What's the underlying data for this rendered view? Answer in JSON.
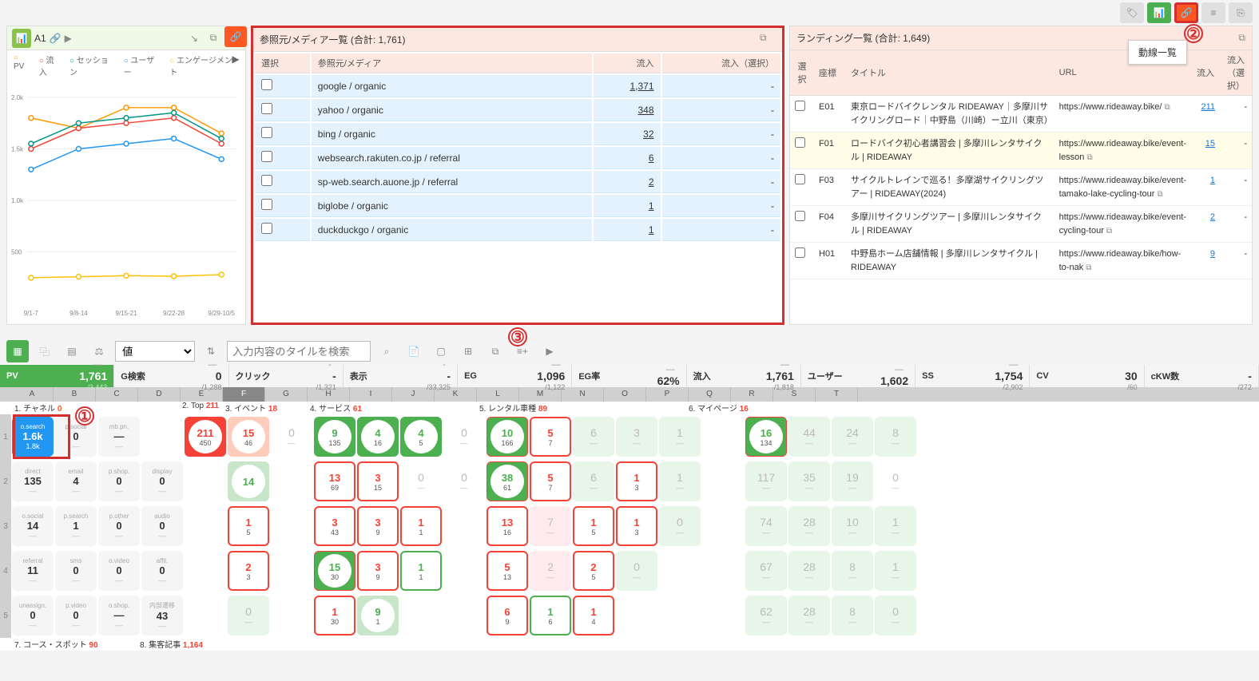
{
  "top_toolbar": {
    "tooltip": "動線一覧",
    "annotation_2": "②"
  },
  "chart_panel": {
    "cell_ref": "A1",
    "legend": [
      "PV",
      "流入",
      "セッション",
      "ユーザー",
      "エンゲージメント"
    ]
  },
  "chart_data": {
    "type": "line",
    "categories": [
      "9/1-7",
      "9/8-14",
      "9/15-21",
      "9/22-28",
      "9/29-10/5"
    ],
    "series": [
      {
        "name": "PV",
        "color": "#ff9800",
        "values": [
          1800,
          1700,
          1900,
          1900,
          1650
        ]
      },
      {
        "name": "流入",
        "color": "#f44336",
        "values": [
          1500,
          1700,
          1750,
          1800,
          1550
        ]
      },
      {
        "name": "セッション",
        "color": "#009688",
        "values": [
          1550,
          1750,
          1800,
          1850,
          1600
        ]
      },
      {
        "name": "ユーザー",
        "color": "#2196f3",
        "values": [
          1300,
          1500,
          1550,
          1600,
          1400
        ]
      },
      {
        "name": "エンゲージメント",
        "color": "#ffc107",
        "values": [
          250,
          260,
          270,
          265,
          280
        ]
      }
    ],
    "ylim": [
      0,
      2000
    ],
    "yticks": [
      "500",
      "1.0k",
      "1.5k",
      "2.0k"
    ]
  },
  "referrer": {
    "title": "参照元/メディア一覧 (合計: 1,761)",
    "annotation_3": "③",
    "columns": [
      "選択",
      "参照元/メディア",
      "流入",
      "流入（選択）"
    ],
    "rows": [
      {
        "name": "google / organic",
        "inflow": "1,371",
        "selected": "-"
      },
      {
        "name": "yahoo / organic",
        "inflow": "348",
        "selected": "-"
      },
      {
        "name": "bing / organic",
        "inflow": "32",
        "selected": "-"
      },
      {
        "name": "websearch.rakuten.co.jp / referral",
        "inflow": "6",
        "selected": "-"
      },
      {
        "name": "sp-web.search.auone.jp / referral",
        "inflow": "2",
        "selected": "-"
      },
      {
        "name": "biglobe / organic",
        "inflow": "1",
        "selected": "-"
      },
      {
        "name": "duckduckgo / organic",
        "inflow": "1",
        "selected": "-"
      }
    ]
  },
  "landing": {
    "title": "ランディング一覧 (合計: 1,649)",
    "columns": [
      "選択",
      "座標",
      "タイトル",
      "URL",
      "流入",
      "流入（選択）"
    ],
    "rows": [
      {
        "coord": "E01",
        "title": "東京ロードバイクレンタル RIDEAWAY｜多摩川サイクリングロード｜中野島（川崎）ー立川（東京）",
        "url": "https://www.rideaway.bike/",
        "inflow": "211",
        "sel": "-",
        "hl": false
      },
      {
        "coord": "F01",
        "title": "ロードバイク初心者講習会 | 多摩川レンタサイクル | RIDEAWAY",
        "url": "https://www.rideaway.bike/event-lesson",
        "inflow": "15",
        "sel": "-",
        "hl": true
      },
      {
        "coord": "F03",
        "title": "サイクルトレインで巡る！多摩湖サイクリングツアー | RIDEAWAY(2024)",
        "url": "https://www.rideaway.bike/event-tamako-lake-cycling-tour",
        "inflow": "1",
        "sel": "-",
        "hl": false
      },
      {
        "coord": "F04",
        "title": "多摩川サイクリングツアー | 多摩川レンタサイクル | RIDEAWAY",
        "url": "https://www.rideaway.bike/event-cycling-tour",
        "inflow": "2",
        "sel": "-",
        "hl": false
      },
      {
        "coord": "H01",
        "title": "中野島ホーム店舗情報 | 多摩川レンタサイクル | RIDEAWAY",
        "url": "https://www.rideaway.bike/how-to-nak",
        "inflow": "9",
        "sel": "-",
        "hl": false
      }
    ]
  },
  "metrics_toolbar": {
    "select_value": "値",
    "search_placeholder": "入力内容のタイルを検索"
  },
  "metrics": [
    {
      "label": "PV",
      "dash": "—",
      "big": "1,761",
      "small": "/3,443",
      "green": true
    },
    {
      "label": "G検索",
      "dash": "—",
      "big": "0",
      "small": "/1,288"
    },
    {
      "label": "クリック",
      "dash": "-",
      "big": "-",
      "small": "/1,321"
    },
    {
      "label": "表示",
      "dash": "-",
      "big": "-",
      "small": "/33,325"
    },
    {
      "label": "EG",
      "dash": "—",
      "big": "1,096",
      "small": "/1,122"
    },
    {
      "label": "EG率",
      "dash": "—",
      "big": "62%",
      "small": ""
    },
    {
      "label": "流入",
      "dash": "—",
      "big": "1,761",
      "small": "/1,818"
    },
    {
      "label": "ユーザー",
      "dash": "—",
      "big": "1,602",
      "small": ""
    },
    {
      "label": "SS",
      "dash": "—",
      "big": "1,754",
      "small": "/2,902"
    },
    {
      "label": "CV",
      "dash": "",
      "big": "30",
      "small": "/60"
    },
    {
      "label": "cKW数",
      "dash": "",
      "big": "-",
      "small": "/272"
    }
  ],
  "col_letters": [
    "A",
    "B",
    "C",
    "D",
    "E",
    "F",
    "G",
    "H",
    "I",
    "J",
    "K",
    "L",
    "M",
    "N",
    "O",
    "P",
    "Q",
    "R",
    "S",
    "T"
  ],
  "sections": [
    {
      "pos": 18,
      "label": "1. チャネル",
      "val": "0",
      "color": "sh-orange"
    },
    {
      "pos": 228,
      "label": "2. Top",
      "val": "211",
      "color": "sh-red"
    },
    {
      "pos": 282,
      "label": "3. イベント",
      "val": "18",
      "color": "sh-red"
    },
    {
      "pos": 388,
      "label": "4. サービス",
      "val": "61",
      "color": "sh-red"
    },
    {
      "pos": 600,
      "label": "5. レンタル車種",
      "val": "89",
      "color": "sh-red"
    },
    {
      "pos": 862,
      "label": "6. マイページ",
      "val": "16",
      "color": "sh-red"
    }
  ],
  "sections_bottom": [
    {
      "pos": 18,
      "label": "7. コース・スポット",
      "val": "90",
      "color": "sh-red"
    },
    {
      "pos": 175,
      "label": "8. 集客記事",
      "val": "1,164",
      "color": "sh-red"
    }
  ],
  "annotation_1": "①",
  "grid": {
    "row1": {
      "channel": [
        {
          "t": "o.search",
          "v1": "1.6k",
          "v2": "1.8k",
          "selblue": true
        },
        {
          "t": "p.social",
          "v": "0"
        },
        {
          "t": "mb.pn.",
          "v": "—"
        }
      ],
      "tiles": [
        {
          "c": "E",
          "v1": "211",
          "v2": "450",
          "bg": "bg-red"
        },
        {
          "c": "F",
          "v1": "15",
          "v2": "46",
          "bg": "bg-orange"
        },
        {
          "c": "G",
          "v": "0"
        },
        {
          "c": "H",
          "v1": "9",
          "v2": "135",
          "bg": "bg-green"
        },
        {
          "c": "I",
          "v1": "4",
          "v2": "16",
          "bg": "bg-green"
        },
        {
          "c": "J",
          "v1": "4",
          "v2": "5",
          "bg": "bg-green"
        },
        {
          "c": "K",
          "v": "0"
        },
        {
          "c": "L",
          "v1": "10",
          "v2": "166",
          "bg": "bg-green",
          "red": true
        },
        {
          "c": "M",
          "v1": "5",
          "v2": "7",
          "bg": "bord-red"
        },
        {
          "c": "N",
          "v": "6",
          "fade": "bg-fade-green"
        },
        {
          "c": "O",
          "v": "3",
          "fade": "bg-fade-green"
        },
        {
          "c": "P",
          "v": "1",
          "fade": "bg-fade-green"
        },
        {
          "c": "Q",
          "blank": true
        },
        {
          "c": "R",
          "v1": "16",
          "v2": "134",
          "bg": "bg-green",
          "red": true
        },
        {
          "c": "S",
          "v": "44",
          "fade": "bg-fade-green"
        },
        {
          "c": "T",
          "v": "24",
          "fade": "bg-fade-green"
        },
        {
          "c": "U",
          "v": "8",
          "fade": "bg-fade-green"
        }
      ]
    },
    "row2": {
      "channel": [
        {
          "t": "direct",
          "v": "135"
        },
        {
          "t": "email",
          "v": "4"
        },
        {
          "t": "p.shop.",
          "v": "0"
        },
        {
          "t": "display",
          "v": "0"
        }
      ],
      "tiles": [
        {
          "c": "E",
          "blank": true
        },
        {
          "c": "F",
          "v1": "14",
          "bg": "bg-lightgreen",
          "single": true
        },
        {
          "c": "G",
          "blank": true
        },
        {
          "c": "H",
          "v1": "13",
          "v2": "69",
          "bg": "bord-red"
        },
        {
          "c": "I",
          "v1": "3",
          "v2": "15",
          "bg": "bord-red"
        },
        {
          "c": "J",
          "v": "0"
        },
        {
          "c": "K",
          "v": "0"
        },
        {
          "c": "L",
          "v1": "38",
          "v2": "61",
          "bg": "bg-green",
          "red": true
        },
        {
          "c": "M",
          "v1": "5",
          "v2": "7",
          "bg": "bord-red"
        },
        {
          "c": "N",
          "v": "6",
          "fade": "bg-fade-green"
        },
        {
          "c": "O",
          "v1": "1",
          "v2": "3",
          "bg": "bord-red"
        },
        {
          "c": "P",
          "v": "1",
          "fade": "bg-fade-green"
        },
        {
          "c": "Q",
          "blank": true
        },
        {
          "c": "R",
          "v": "117",
          "fade": "bg-fade-green"
        },
        {
          "c": "S",
          "v": "35",
          "fade": "bg-fade-green"
        },
        {
          "c": "T",
          "v": "19",
          "fade": "bg-fade-green"
        },
        {
          "c": "U",
          "v": "0"
        }
      ]
    },
    "row3": {
      "channel": [
        {
          "t": "o.social",
          "v": "14"
        },
        {
          "t": "p.search",
          "v": "1"
        },
        {
          "t": "p.other",
          "v": "0"
        },
        {
          "t": "audio",
          "v": "0"
        }
      ],
      "tiles": [
        {
          "c": "E",
          "blank": true
        },
        {
          "c": "F",
          "v1": "1",
          "v2": "5",
          "bg": "bord-red"
        },
        {
          "c": "G",
          "blank": true
        },
        {
          "c": "H",
          "v1": "3",
          "v2": "43",
          "bg": "bord-red"
        },
        {
          "c": "I",
          "v1": "3",
          "v2": "9",
          "bg": "bord-red"
        },
        {
          "c": "J",
          "v1": "1",
          "v2": "1",
          "bg": "bord-red"
        },
        {
          "c": "K",
          "blank": true
        },
        {
          "c": "L",
          "v1": "13",
          "v2": "16",
          "bg": "bord-red"
        },
        {
          "c": "M",
          "v": "7",
          "fade": "bg-fade-red"
        },
        {
          "c": "N",
          "v1": "1",
          "v2": "5",
          "bg": "bord-red"
        },
        {
          "c": "O",
          "v1": "1",
          "v2": "3",
          "bg": "bord-red"
        },
        {
          "c": "P",
          "v": "0",
          "fade": "bg-fade-green"
        },
        {
          "c": "Q",
          "blank": true
        },
        {
          "c": "R",
          "v": "74",
          "fade": "bg-fade-green"
        },
        {
          "c": "S",
          "v": "28",
          "fade": "bg-fade-green"
        },
        {
          "c": "T",
          "v": "10",
          "fade": "bg-fade-green"
        },
        {
          "c": "U",
          "v": "1",
          "fade": "bg-fade-green"
        }
      ]
    },
    "row4": {
      "channel": [
        {
          "t": "referral",
          "v": "11"
        },
        {
          "t": "sms",
          "v": "0"
        },
        {
          "t": "o.video",
          "v": "0"
        },
        {
          "t": "affil.",
          "v": "0"
        }
      ],
      "tiles": [
        {
          "c": "E",
          "blank": true
        },
        {
          "c": "F",
          "v1": "2",
          "v2": "3",
          "bg": "bord-red"
        },
        {
          "c": "G",
          "blank": true
        },
        {
          "c": "H",
          "v1": "15",
          "v2": "30",
          "bg": "bg-green",
          "red": true
        },
        {
          "c": "I",
          "v1": "3",
          "v2": "9",
          "bg": "bord-red"
        },
        {
          "c": "J",
          "v1": "1",
          "v2": "1",
          "bg": "bord-green"
        },
        {
          "c": "K",
          "blank": true
        },
        {
          "c": "L",
          "v1": "5",
          "v2": "13",
          "bg": "bord-red"
        },
        {
          "c": "M",
          "v": "2",
          "fade": "bg-fade-red"
        },
        {
          "c": "N",
          "v1": "2",
          "v2": "5",
          "bg": "bord-red"
        },
        {
          "c": "O",
          "v": "0",
          "fade": "bg-fade-green"
        },
        {
          "c": "P",
          "blank": true
        },
        {
          "c": "Q",
          "blank": true
        },
        {
          "c": "R",
          "v": "67",
          "fade": "bg-fade-green"
        },
        {
          "c": "S",
          "v": "28",
          "fade": "bg-fade-green"
        },
        {
          "c": "T",
          "v": "8",
          "fade": "bg-fade-green"
        },
        {
          "c": "U",
          "v": "1",
          "fade": "bg-fade-green"
        }
      ]
    },
    "row5": {
      "channel": [
        {
          "t": "unassign.",
          "v": "0"
        },
        {
          "t": "p.video",
          "v": "0"
        },
        {
          "t": "o.shop.",
          "v": "—"
        },
        {
          "t": "内部遷移",
          "v": "43"
        }
      ],
      "tiles": [
        {
          "c": "E",
          "blank": true
        },
        {
          "c": "F",
          "v": "0",
          "fade": "bg-fade-green"
        },
        {
          "c": "G",
          "blank": true
        },
        {
          "c": "H",
          "v1": "1",
          "v2": "30",
          "bg": "bord-red"
        },
        {
          "c": "I",
          "v1": "9",
          "v2": "1",
          "bg": "bg-lightgreen"
        },
        {
          "c": "J",
          "blank": true
        },
        {
          "c": "K",
          "blank": true
        },
        {
          "c": "L",
          "v1": "6",
          "v2": "9",
          "bg": "bord-red"
        },
        {
          "c": "M",
          "v1": "1",
          "v2": "6",
          "bg": "bord-green"
        },
        {
          "c": "N",
          "v1": "1",
          "v2": "4",
          "bg": "bord-red"
        },
        {
          "c": "O",
          "blank": true
        },
        {
          "c": "P",
          "blank": true
        },
        {
          "c": "Q",
          "blank": true
        },
        {
          "c": "R",
          "v": "62",
          "fade": "bg-fade-green"
        },
        {
          "c": "S",
          "v": "28",
          "fade": "bg-fade-green"
        },
        {
          "c": "T",
          "v": "8",
          "fade": "bg-fade-green"
        },
        {
          "c": "U",
          "v": "0",
          "fade": "bg-fade-green"
        }
      ]
    }
  }
}
